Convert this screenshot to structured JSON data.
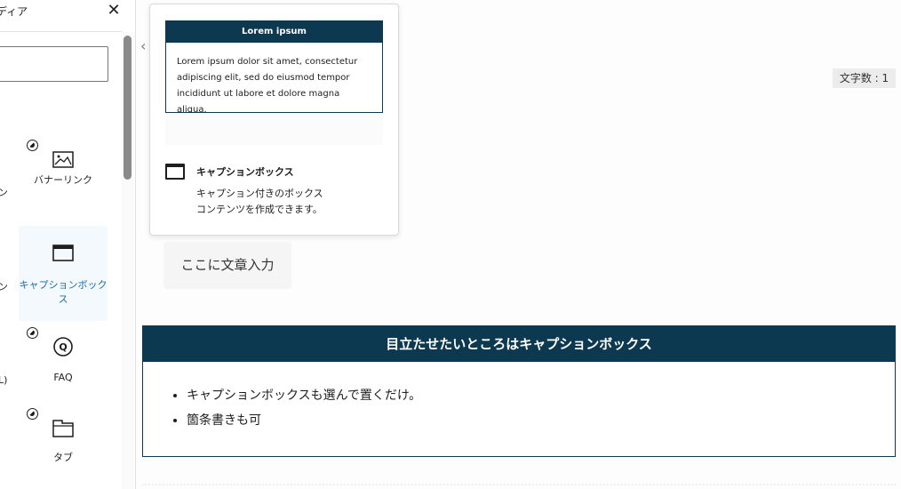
{
  "panel": {
    "title": "ディア",
    "close_icon": "close-icon",
    "search": {
      "value": "",
      "placeholder": ""
    },
    "items": [
      {
        "label": "バナーリンク",
        "icon": "banner-link-icon",
        "selected": false
      },
      {
        "label": "キャプションボックス",
        "icon": "caption-box-icon",
        "selected": true
      },
      {
        "label": "FAQ",
        "icon": "faq-icon",
        "selected": false
      },
      {
        "label": "タブ",
        "icon": "tab-icon",
        "selected": false
      }
    ],
    "cut_labels": [
      "ン",
      "ン",
      "L)"
    ]
  },
  "popover": {
    "preview_title": "Lorem ipsum",
    "preview_text": "Lorem ipsum dolor sit amet, consectetur adipiscing elit, sed do eiusmod tempor incididunt ut labore et dolore magna aliqua.",
    "block_title": "キャプションボックス",
    "block_desc_line1": "キャプション付きのボックス",
    "block_desc_line2": "コンテンツを作成できます。"
  },
  "editor": {
    "char_count": "文字数 : 1",
    "paragraph_placeholder": "ここに文章入力",
    "caption_box": {
      "title": "目立たせたいところはキャプションボックス",
      "items": [
        "キャプションボックスも選んで置くだけ。",
        "箇条書きも可"
      ]
    }
  },
  "colors": {
    "accent": "#0c3850",
    "selected_label": "#1a6fa6"
  }
}
